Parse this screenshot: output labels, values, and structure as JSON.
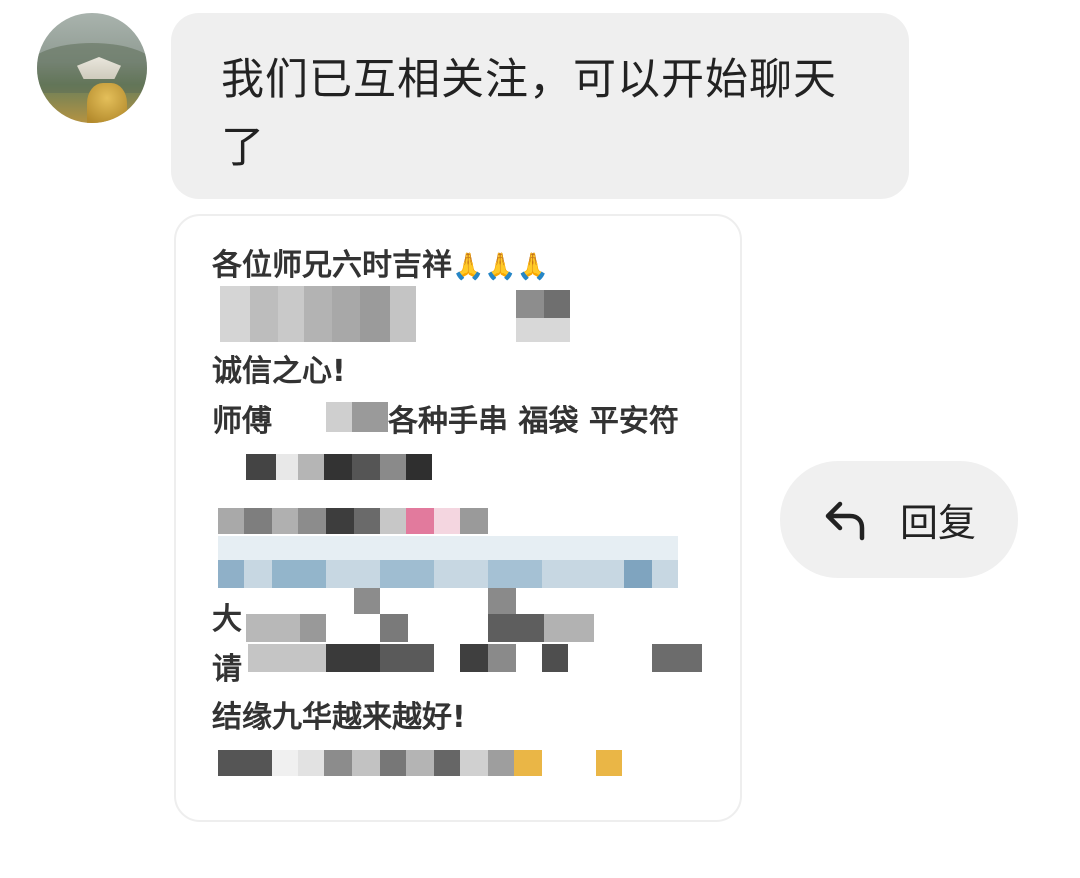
{
  "chat": {
    "received_message": "我们已互相关注，可以开始聊天了"
  },
  "card": {
    "lines": [
      "各位师兄六时吉祥",
      "诚信之心!",
      "师傅",
      "各种手串 福袋 平安符",
      "大",
      "请",
      "结缘九华越来越好!"
    ],
    "emoji": "🙏🙏🙏"
  },
  "actions": {
    "reply_label": "回复",
    "reply_icon": "reply-arrow-icon"
  },
  "colors": {
    "bubble_bg": "#efefef",
    "reply_bg": "#f0f0f0",
    "text": "#222222"
  }
}
